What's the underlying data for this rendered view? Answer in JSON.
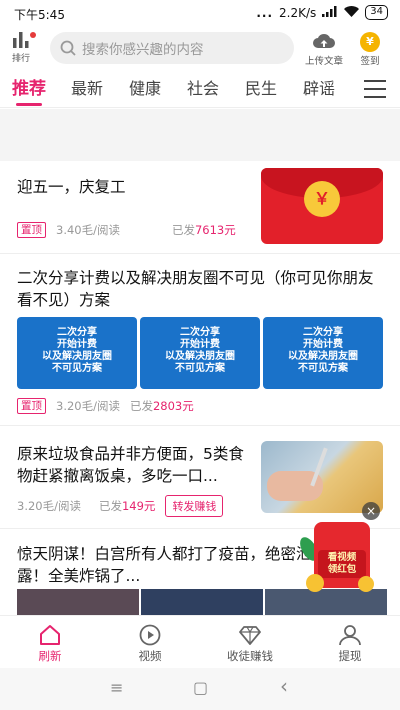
{
  "status_bar": {
    "time": "下午5:45",
    "dots": "...",
    "network": "2.2K/s",
    "battery": "34"
  },
  "top_bar": {
    "rank_label": "排行",
    "search_placeholder": "搜索你感兴趣的内容",
    "upload_label": "上传文章",
    "signin_label": "签到",
    "signin_coin": "¥"
  },
  "tabs": [
    "推荐",
    "最新",
    "健康",
    "社会",
    "民生",
    "辟谣"
  ],
  "articles": [
    {
      "title": "迎五一，庆复工",
      "badge": "置顶",
      "rate": "3.40毛/阅读",
      "sent_prefix": "已发",
      "sent_count": "7613元",
      "image_symbol": "￥"
    },
    {
      "title": "二次分享计费以及解决朋友圈不可见（你可见你朋友看不见）方案",
      "badge": "置顶",
      "rate": "3.20毛/阅读",
      "sent_prefix": "已发",
      "sent_count": "2803元",
      "image_text": [
        "二次分享",
        "开始计费",
        "以及解决朋友圈",
        "不可见方案"
      ]
    },
    {
      "title": "原来垃圾食品并非方便面，5类食物赶紧撤离饭桌，多吃一口...",
      "rate": "3.20毛/阅读",
      "sent_prefix": "已发",
      "sent_count": "149元",
      "forward_label": "转发赚钱",
      "close_symbol": "×"
    },
    {
      "title": "惊天阴谋！白宫所有人都打了疫苗，绝密泄露！全美炸锅了..."
    }
  ],
  "floating_red_packet": {
    "label_line1": "看视频",
    "label_line2": "领红包"
  },
  "bottom_nav": [
    {
      "label": "刷新",
      "icon": "home-icon",
      "active": true
    },
    {
      "label": "视频",
      "icon": "play-icon",
      "active": false
    },
    {
      "label": "收徒赚钱",
      "icon": "diamond-icon",
      "active": false
    },
    {
      "label": "提现",
      "icon": "user-icon",
      "active": false
    }
  ],
  "system_nav": {
    "menu": "≡",
    "home": "▢",
    "back": "‹"
  },
  "colors": {
    "accent": "#e6246e",
    "blue_image": "#1a72c9",
    "red_envelope": "#e2202a"
  }
}
